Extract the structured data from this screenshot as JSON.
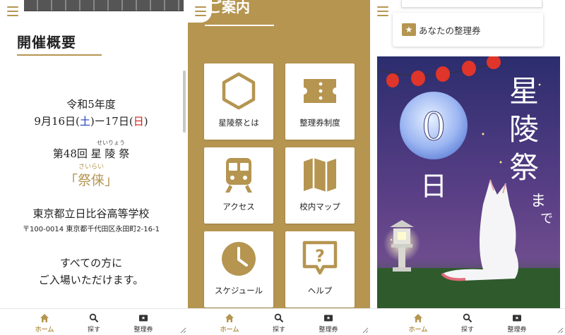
{
  "nav": {
    "home_label": "ホーム",
    "search_label": "探す",
    "ticket_label": "整理券"
  },
  "overview": {
    "heading": "開催概要",
    "era": "令和5年度",
    "dates": {
      "start": "9月16日(",
      "sat": "土",
      "mid": ")ー17日(",
      "sun": "日",
      "end": ")"
    },
    "ruby_seiryo": "せいりょう",
    "festival_line": "第48回 星 陵 祭",
    "ruby_sairai": "さいらい",
    "theme": "「祭俫」",
    "school": "東京都立日比谷高等学校",
    "address": "〒100-0014 東京都千代田区永田町2-16-1",
    "welcome_line1": "すべての方に",
    "welcome_line2": "ご入場いただけます。"
  },
  "guide": {
    "title": "ご案内",
    "tiles": [
      {
        "label": "星陵祭とは",
        "icon": "hexagon-icon"
      },
      {
        "label": "整理券制度",
        "icon": "ticket-icon"
      },
      {
        "label": "アクセス",
        "icon": "train-icon"
      },
      {
        "label": "校内マップ",
        "icon": "map-icon"
      },
      {
        "label": "スケジュール",
        "icon": "clock-icon"
      },
      {
        "label": "ヘルプ",
        "icon": "help-icon"
      }
    ]
  },
  "countdown": {
    "ticket_button_label": "あなたの整理券",
    "days": "0",
    "day_unit": "日",
    "title_chars": [
      "星",
      "陵",
      "祭"
    ],
    "made_chars": [
      "ま",
      "で"
    ]
  },
  "colors": {
    "accent": "#b59550",
    "saturday": "#1f3fbf",
    "sunday": "#d0201a"
  }
}
